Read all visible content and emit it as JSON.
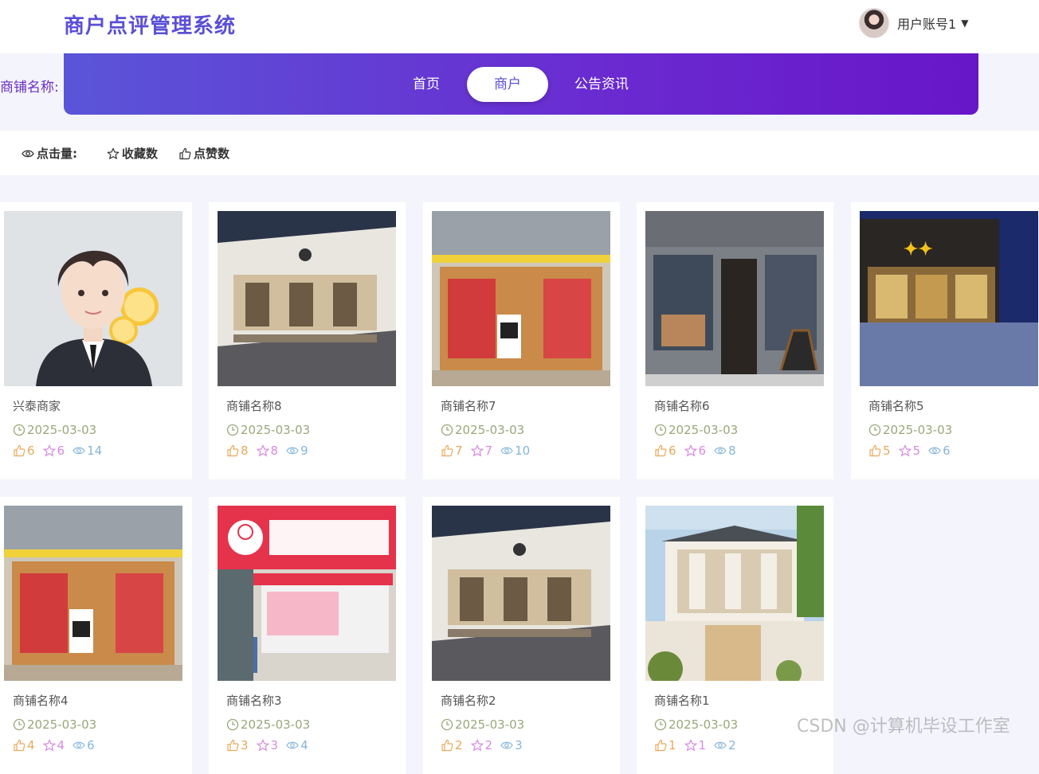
{
  "header": {
    "app_title": "商户点评管理系统",
    "user_name": "用户账号1",
    "caret": "▼"
  },
  "search": {
    "label": "商铺名称:"
  },
  "nav": {
    "home": "首页",
    "merchant": "商户",
    "notice": "公告资讯"
  },
  "sort": {
    "views": "点击量:",
    "favorites": "收藏数",
    "likes": "点赞数"
  },
  "cards": [
    {
      "name": "兴泰商家",
      "date": "2025-03-03",
      "likes": "6",
      "favorites": "6",
      "views": "14"
    },
    {
      "name": "商铺名称8",
      "date": "2025-03-03",
      "likes": "8",
      "favorites": "8",
      "views": "9"
    },
    {
      "name": "商铺名称7",
      "date": "2025-03-03",
      "likes": "7",
      "favorites": "7",
      "views": "10"
    },
    {
      "name": "商铺名称6",
      "date": "2025-03-03",
      "likes": "6",
      "favorites": "6",
      "views": "8"
    },
    {
      "name": "商铺名称5",
      "date": "2025-03-03",
      "likes": "5",
      "favorites": "5",
      "views": "6"
    },
    {
      "name": "商铺名称4",
      "date": "2025-03-03",
      "likes": "4",
      "favorites": "4",
      "views": "6"
    },
    {
      "name": "商铺名称3",
      "date": "2025-03-03",
      "likes": "3",
      "favorites": "3",
      "views": "4"
    },
    {
      "name": "商铺名称2",
      "date": "2025-03-03",
      "likes": "2",
      "favorites": "2",
      "views": "3"
    },
    {
      "name": "商铺名称1",
      "date": "2025-03-03",
      "likes": "1",
      "favorites": "1",
      "views": "2"
    }
  ],
  "watermark": "CSDN @计算机毕设工作室",
  "colors": {
    "brand": "#5a4fd6",
    "nav_gradient_end": "#6816c8"
  }
}
